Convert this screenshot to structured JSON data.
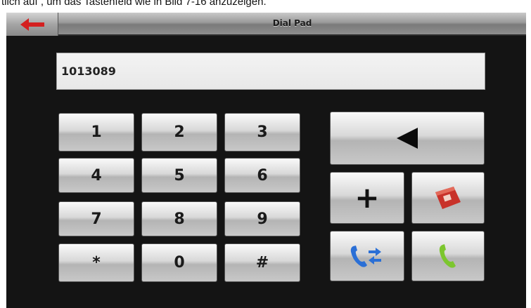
{
  "caption": "tlich auf , um das Tastenfeld wie in Bild 7-16 anzuzeigen.",
  "header": {
    "title": "Dial Pad",
    "back_icon": "back-arrow-icon",
    "back_color": "#d42020"
  },
  "display": {
    "number": "1013089"
  },
  "keypad": {
    "keys": [
      "1",
      "2",
      "3",
      "4",
      "5",
      "6",
      "7",
      "8",
      "9",
      "*",
      "0",
      "#"
    ]
  },
  "actions": {
    "backspace_icon": "backspace-triangle-icon",
    "plus_label": "+",
    "contacts_icon": "phonebook-icon",
    "contacts_color": "#c8322a",
    "transfer_icon": "call-transfer-icon",
    "transfer_color": "#2a6fd6",
    "call_icon": "call-icon",
    "call_color": "#7cc62e"
  }
}
